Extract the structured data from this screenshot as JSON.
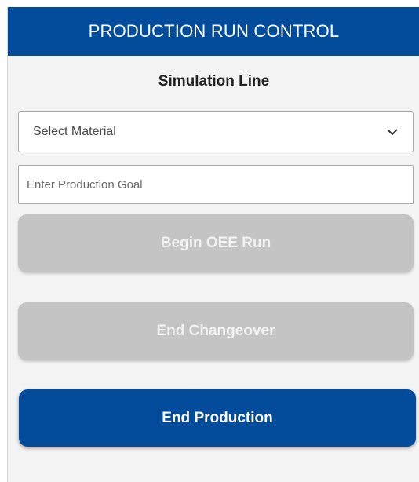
{
  "panel": {
    "title": "PRODUCTION RUN CONTROL",
    "line_name": "Simulation Line"
  },
  "material_select": {
    "selected": "Select Material",
    "icon": "chevron-down-icon"
  },
  "production_goal": {
    "value": "",
    "placeholder": "Enter Production Goal"
  },
  "buttons": {
    "begin_oee_run": "Begin OEE Run",
    "end_changeover": "End Changeover",
    "end_production": "End Production"
  },
  "colors": {
    "brand": "#034c9c",
    "disabled": "#c4c4c4",
    "panel_background": "#f3f3f3"
  }
}
